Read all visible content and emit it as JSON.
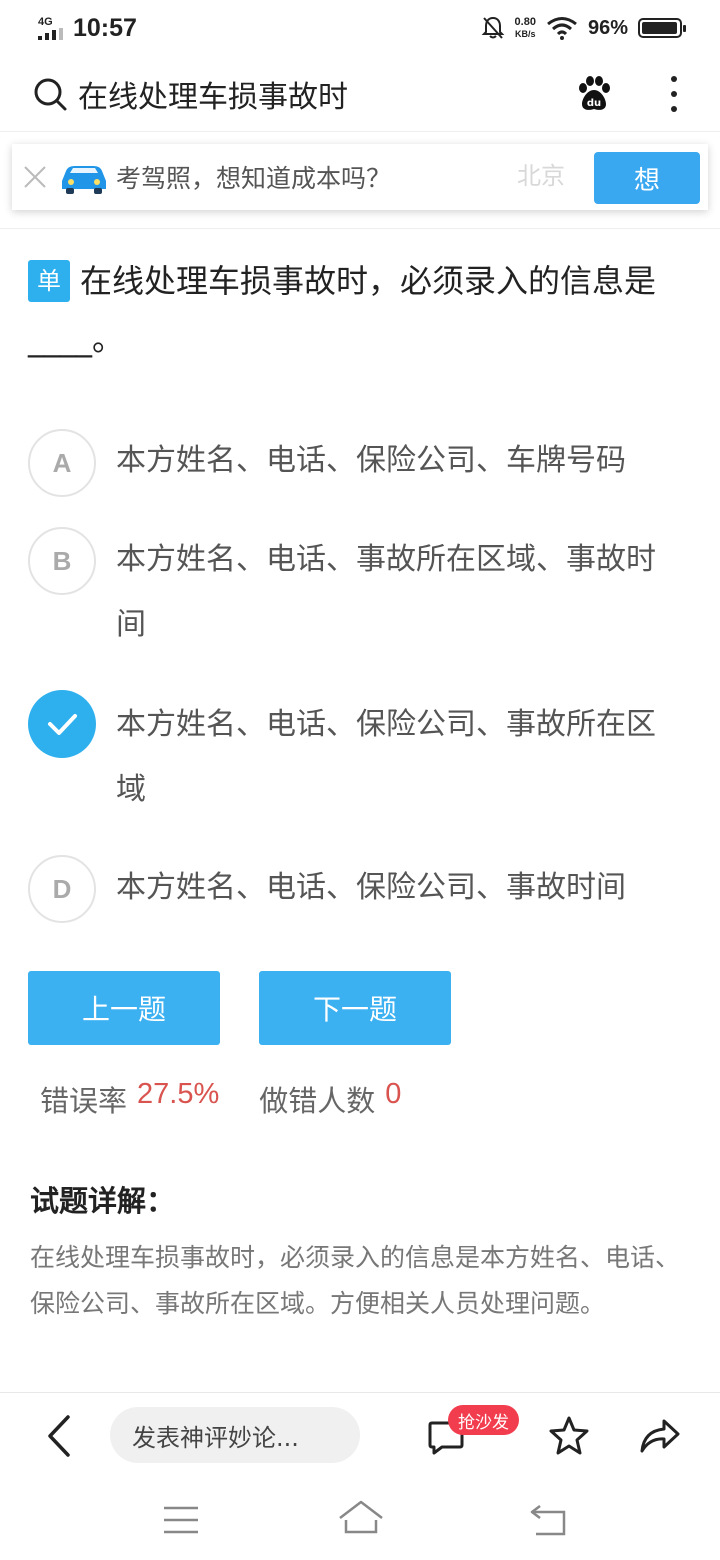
{
  "status_bar": {
    "network": "4G",
    "time": "10:57",
    "speed_value": "0.80",
    "speed_unit": "KB/s",
    "battery": "96%",
    "battery_level": 0.96
  },
  "header": {
    "search_query": "在线处理车损事故时"
  },
  "ad": {
    "text": "考驾照，想知道成本吗？",
    "faded_text": "北京",
    "button_label": "想"
  },
  "question": {
    "type_badge": "单",
    "text": "在线处理车损事故时，必须录入的信息是____。",
    "options": [
      {
        "letter": "A",
        "text": "本方姓名、电话、保险公司、车牌号码",
        "selected": false
      },
      {
        "letter": "B",
        "text": "本方姓名、电话、事故所在区域、事故时间",
        "selected": false
      },
      {
        "letter": "C",
        "text": "本方姓名、电话、保险公司、事故所在区域",
        "selected": true
      },
      {
        "letter": "D",
        "text": "本方姓名、电话、保险公司、事故时间",
        "selected": false
      }
    ]
  },
  "navigation": {
    "prev_label": "上一题",
    "next_label": "下一题"
  },
  "stats": {
    "error_rate_label": "错误率",
    "error_rate_value": "27.5%",
    "wrong_count_label": "做错人数",
    "wrong_count_value": "0"
  },
  "explanation": {
    "title": "试题详解：",
    "body": "在线处理车损事故时，必须录入的信息是本方姓名、电话、保险公司、事故所在区域。方便相关人员处理问题。"
  },
  "bottom_bar": {
    "comment_placeholder": "发表神评妙论...",
    "sofa_badge": "抢沙发"
  },
  "colors": {
    "accent": "#3cb1f2",
    "badge_red": "#f23d4f",
    "stat_red": "#d9534f"
  }
}
